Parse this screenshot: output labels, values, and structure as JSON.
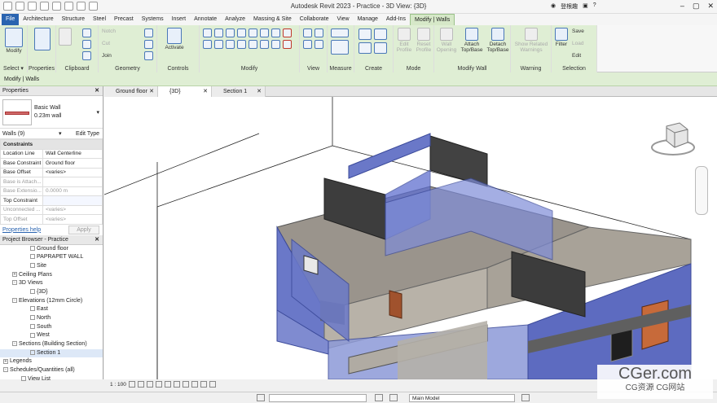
{
  "app": {
    "title": "Autodesk Revit 2023 - Practice - 3D View: {3D}",
    "user": "登根趣"
  },
  "tabs": [
    "File",
    "Architecture",
    "Structure",
    "Steel",
    "Precast",
    "Systems",
    "Insert",
    "Annotate",
    "Analyze",
    "Massing & Site",
    "Collaborate",
    "View",
    "Manage",
    "Add-Ins",
    "Modify | Walls"
  ],
  "ribbon": {
    "modify": "Modify",
    "select": "Select ▾",
    "properties": "Properties",
    "clipboard": "Clipboard",
    "notch": "Notch",
    "cut": "Cut",
    "join": "Join",
    "geometry": "Geometry",
    "activate": "Activate",
    "controls": "Controls",
    "modify_group": "Modify",
    "view": "View",
    "measure": "Measure",
    "create": "Create",
    "edit_profile": "Edit Profile",
    "reset_profile": "Reset Profile",
    "mode": "Mode",
    "wall_opening": "Wall Opening",
    "attach": "Attach Top/Base",
    "detach": "Detach Top/Base",
    "modify_wall": "Modify Wall",
    "show_warnings": "Show Related Warnings",
    "warning": "Warning",
    "filter": "Filter",
    "save": "Save",
    "load": "Load",
    "edit": "Edit",
    "selection": "Selection"
  },
  "context_bar": "Modify | Walls",
  "properties": {
    "title": "Properties",
    "type_name": "Basic Wall",
    "type_sub": "0.23m wall",
    "filter": "Walls (9)",
    "edit_type": "Edit Type",
    "rows": [
      {
        "k": "Constraints",
        "v": "",
        "cat": true
      },
      {
        "k": "Location Line",
        "v": "Wall Centerline"
      },
      {
        "k": "Base Constraint",
        "v": "Ground floor"
      },
      {
        "k": "Base Offset",
        "v": "<varies>"
      },
      {
        "k": "Base is Attach...",
        "v": "",
        "dim": true
      },
      {
        "k": "Base Extensio...",
        "v": "0.0000 m",
        "dim": true
      },
      {
        "k": "Top Constraint",
        "v": "",
        "sel": true
      },
      {
        "k": "Unconnected ...",
        "v": "<varies>",
        "dim": true
      },
      {
        "k": "Top Offset",
        "v": "<varies>",
        "dim": true
      }
    ],
    "help": "Properties help",
    "apply": "Apply"
  },
  "browser": {
    "title": "Project Browser - Practice",
    "items": [
      {
        "t": "Ground floor",
        "d": 3,
        "b": "none"
      },
      {
        "t": "PAPRAPET WALL",
        "d": 3,
        "b": "none"
      },
      {
        "t": "Site",
        "d": 3,
        "b": "none"
      },
      {
        "t": "Ceiling Plans",
        "d": 1,
        "b": "+"
      },
      {
        "t": "3D Views",
        "d": 1,
        "b": "-"
      },
      {
        "t": "{3D}",
        "d": 3,
        "b": "none"
      },
      {
        "t": "Elevations (12mm Circle)",
        "d": 1,
        "b": "-"
      },
      {
        "t": "East",
        "d": 3,
        "b": "none"
      },
      {
        "t": "North",
        "d": 3,
        "b": "none"
      },
      {
        "t": "South",
        "d": 3,
        "b": "none"
      },
      {
        "t": "West",
        "d": 3,
        "b": "none"
      },
      {
        "t": "Sections (Building Section)",
        "d": 1,
        "b": "-"
      },
      {
        "t": "Section 1",
        "d": 3,
        "b": "none",
        "sel": true
      },
      {
        "t": "Legends",
        "d": 0,
        "b": "+"
      },
      {
        "t": "Schedules/Quantities (all)",
        "d": 0,
        "b": "-"
      },
      {
        "t": "View List",
        "d": 2,
        "b": "none"
      }
    ]
  },
  "view_tabs": [
    {
      "t": "Ground floor"
    },
    {
      "t": "{3D}",
      "active": true
    },
    {
      "t": "Section 1"
    }
  ],
  "viewbar": {
    "scale": "1 : 100"
  },
  "status": {
    "model": "Main Model"
  },
  "watermark": {
    "a": "CGer.com",
    "b": "CG资源 CG网站"
  }
}
